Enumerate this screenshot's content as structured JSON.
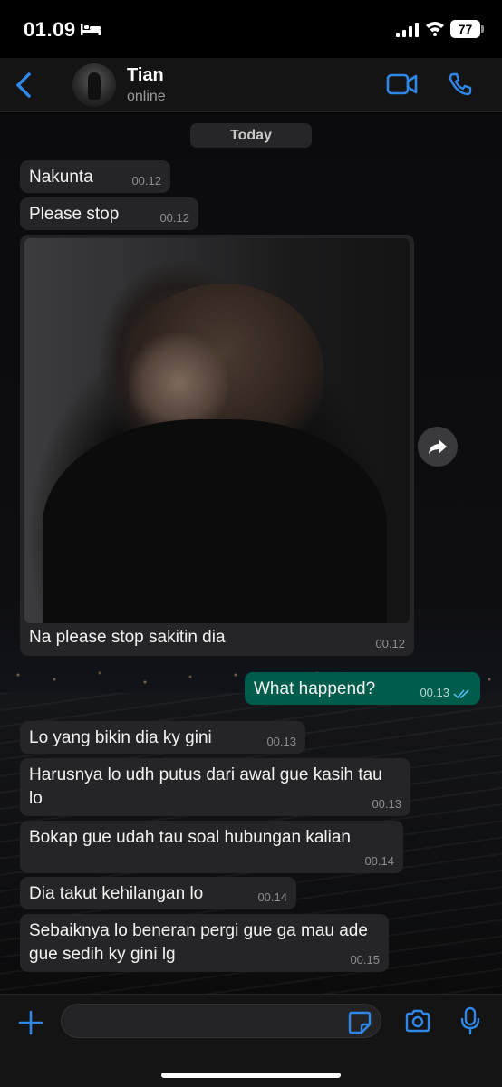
{
  "status_bar": {
    "time": "01.09",
    "battery": "77",
    "icons": [
      "bed-icon",
      "signal-icon",
      "wifi-icon",
      "battery-icon"
    ]
  },
  "header": {
    "contact_name": "Tian",
    "contact_status": "online",
    "icons": [
      "back-icon",
      "avatar",
      "video-call-icon",
      "voice-call-icon"
    ],
    "accent_color": "#2f87e8"
  },
  "chat": {
    "date_label": "Today",
    "messages": [
      {
        "direction": "in",
        "text": "Nakunta",
        "time": "00.12"
      },
      {
        "direction": "in",
        "text": "Please stop",
        "time": "00.12"
      },
      {
        "direction": "in",
        "type": "photo",
        "caption": "Na please stop sakitin dia",
        "time": "00.12"
      },
      {
        "direction": "out",
        "text": "What happend?",
        "time": "00.13",
        "read": true
      },
      {
        "direction": "in",
        "text": "Lo yang bikin dia ky gini",
        "time": "00.13"
      },
      {
        "direction": "in",
        "text": "Harusnya lo udh putus dari awal gue kasih tau lo",
        "time": "00.13"
      },
      {
        "direction": "in",
        "text": "Bokap gue udah tau soal hubungan kalian",
        "time": "00.14"
      },
      {
        "direction": "in",
        "text": "Dia takut kehilangan lo",
        "time": "00.14"
      },
      {
        "direction": "in",
        "text": "Sebaiknya lo beneran pergi gue ga mau ade gue sedih ky gini lg",
        "time": "00.15"
      }
    ],
    "colors": {
      "incoming_bubble": "#252527",
      "outgoing_bubble": "#005c4b",
      "read_ticks": "#53bdeb"
    }
  },
  "input_bar": {
    "message_value": "",
    "icons": [
      "plus-icon",
      "sticker-icon",
      "camera-icon",
      "mic-icon"
    ]
  }
}
